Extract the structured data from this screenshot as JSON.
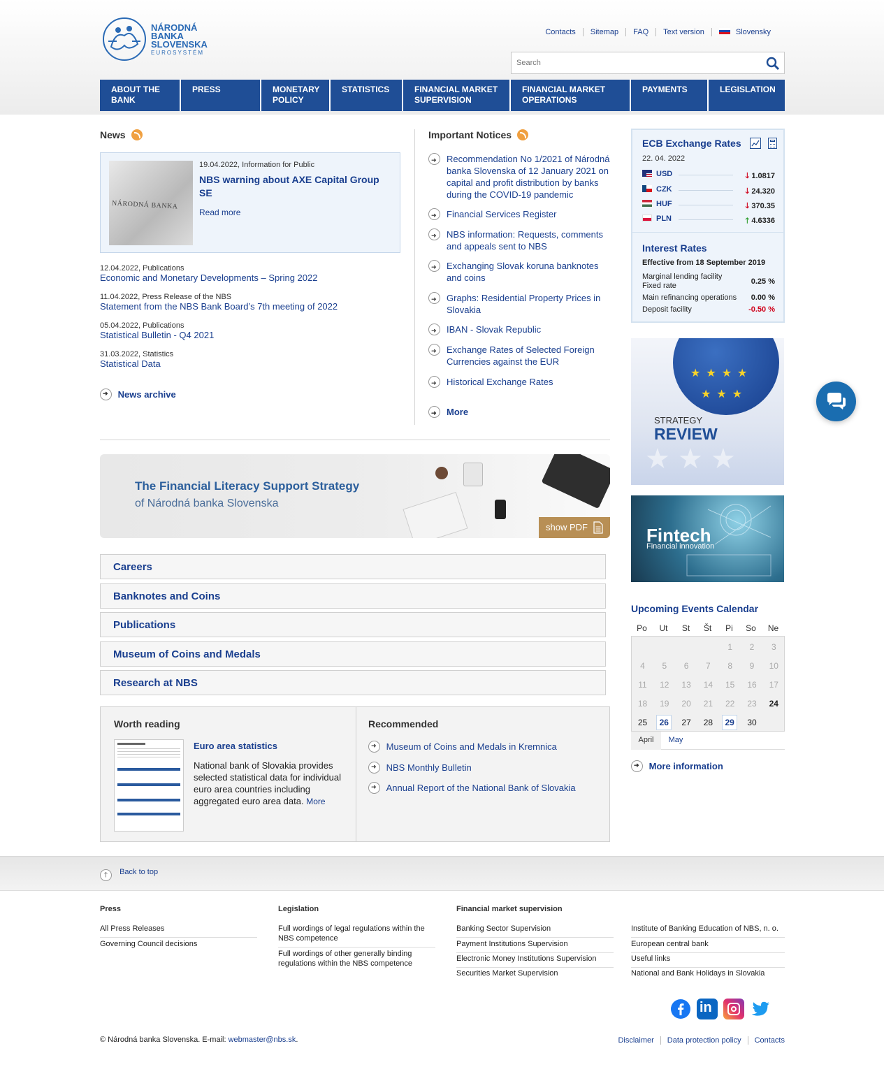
{
  "header": {
    "logo_lines": [
      "NÁRODNÁ",
      "BANKA",
      "SLOVENSKA",
      "EUROSYSTÉM"
    ],
    "top_links": [
      "Contacts",
      "Sitemap",
      "FAQ",
      "Text version",
      "Slovensky"
    ],
    "search_placeholder": "Search"
  },
  "nav": [
    {
      "label": "About the bank"
    },
    {
      "label": "Press"
    },
    {
      "label": "Monetary policy"
    },
    {
      "label": "Statistics"
    },
    {
      "label": "Financial market supervision"
    },
    {
      "label": "Financial market operations"
    },
    {
      "label": "Payments"
    },
    {
      "label": "Legislation"
    }
  ],
  "news": {
    "title": "News",
    "feature": {
      "thumb_text": "NÁRODNÁ BANKA",
      "meta": "19.04.2022, Information for Public",
      "headline": "NBS warning about AXE Capital Group SE",
      "read_more": "Read more"
    },
    "items": [
      {
        "meta": "12.04.2022, Publications",
        "title": "Economic and Monetary Developments – Spring 2022"
      },
      {
        "meta": "11.04.2022, Press Release of the NBS",
        "title": "Statement from the NBS Bank Board’s 7th meeting of 2022"
      },
      {
        "meta": "05.04.2022, Publications",
        "title": "Statistical Bulletin - Q4 2021"
      },
      {
        "meta": "31.03.2022, Statistics",
        "title": "Statistical Data"
      }
    ],
    "archive": "News archive"
  },
  "notices": {
    "title": "Important Notices",
    "items": [
      "Recommendation No 1/2021 of Národná banka Slovenska of 12 January 2021 on capital and profit distribution by banks during the COVID-19 pandemic",
      "Financial Services Register",
      "NBS information: Requests, comments and appeals sent to NBS",
      "Exchanging Slovak koruna banknotes and coins",
      "Graphs: Residential Property Prices in Slovakia",
      "IBAN - Slovak Republic",
      "Exchange Rates of Selected Foreign Currencies against the EUR",
      "Historical Exchange Rates"
    ],
    "more": "More"
  },
  "ecb": {
    "title": "ECB Exchange Rates",
    "date": "22. 04. 2022",
    "rates": [
      {
        "code": "USD",
        "value": "1.0817",
        "dir": "down"
      },
      {
        "code": "CZK",
        "value": "24.320",
        "dir": "down"
      },
      {
        "code": "HUF",
        "value": "370.35",
        "dir": "down"
      },
      {
        "code": "PLN",
        "value": "4.6336",
        "dir": "up"
      }
    ],
    "interest_title": "Interest Rates",
    "effective": "Effective from 18 September 2019",
    "interest": [
      {
        "label": "Marginal lending facility",
        "label2": "Fixed rate",
        "value": "0.25 %",
        "color": "#222222"
      },
      {
        "label": "Main refinancing operations",
        "value": "0.00 %",
        "color": "#222222"
      },
      {
        "label": "Deposit facility",
        "value": "-0.50 %",
        "color": "#d0021b"
      }
    ]
  },
  "banners": {
    "strategy_small": "STRATEGY",
    "strategy_big": "REVIEW",
    "fintech_big": "Fintech",
    "fintech_small": "Financial innovation",
    "literacy_line1": "The Financial Literacy Support Strategy",
    "literacy_line2": "of Národná banka Slovenska",
    "show_pdf": "show PDF"
  },
  "link_boxes": [
    "Careers",
    "Banknotes and Coins",
    "Publications",
    "Museum of Coins and Medals",
    "Research at NBS"
  ],
  "worth_reading": {
    "title": "Worth reading",
    "item_title": "Euro area statistics",
    "item_text": "National bank of Slovakia provides selected statistical data for individual euro area countries including aggregated euro area data.",
    "more": "More"
  },
  "recommended": {
    "title": "Recommended",
    "items": [
      "Museum of Coins and Medals in Kremnica",
      "NBS Monthly Bulletin",
      "Annual Report of the National Bank of Slovakia"
    ]
  },
  "calendar": {
    "title": "Upcoming Events Calendar",
    "days": [
      "Po",
      "Ut",
      "St",
      "Št",
      "Pi",
      "So",
      "Ne"
    ],
    "months": [
      "April",
      "May"
    ],
    "more": "More information"
  },
  "footer": {
    "back_to_top": "Back to top",
    "columns": [
      {
        "title": "Press",
        "links": [
          "All Press Releases",
          "Governing Council decisions"
        ]
      },
      {
        "title": "Legislation",
        "links": [
          "Full wordings of legal regulations within the NBS competence",
          "Full wordings of other generally binding regulations within the NBS competence"
        ]
      },
      {
        "title": "Financial market supervision",
        "links": [
          "Banking Sector Supervision",
          "Payment Institutions Supervision",
          "Electronic Money Institutions Supervision",
          "Securities Market Supervision"
        ]
      },
      {
        "title": "",
        "links": [
          "Institute of Banking Education of NBS, n. o.",
          "European central bank",
          "Useful links",
          "National and Bank Holidays in Slovakia"
        ]
      }
    ],
    "copyright": "© Národná banka Slovenska. E-mail: ",
    "email": "webmaster@nbs.sk",
    "copyright_end": ".",
    "bottom_links": [
      "Disclaimer",
      "Data protection policy",
      "Contacts"
    ],
    "social_icons": [
      "facebook-icon",
      "linkedin-icon",
      "instagram-icon",
      "twitter-icon"
    ]
  },
  "colors": {
    "brand_blue": "#1f4e96",
    "link_blue": "#1a3f8f",
    "down_red": "#d0021b",
    "up_green": "#2e9e2e"
  }
}
